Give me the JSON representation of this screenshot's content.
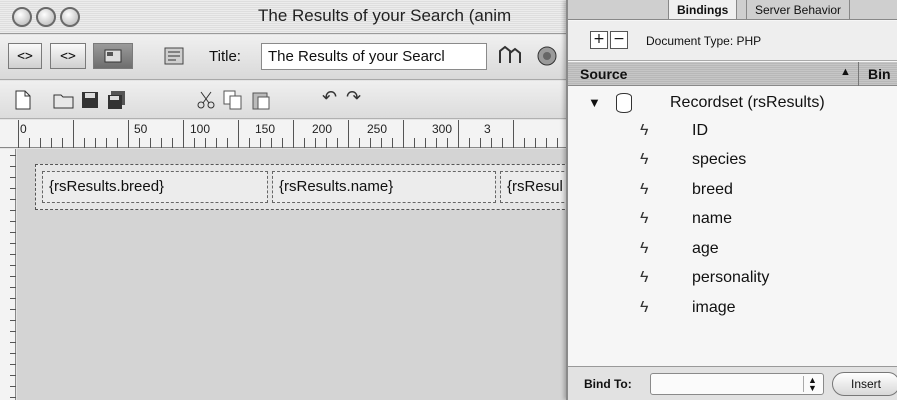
{
  "window": {
    "title": "The Results of your Search (anim"
  },
  "toolbar": {
    "code_view_label": "<>",
    "split_view_label": "<>",
    "design_view_label": "",
    "title_label": "Title:",
    "title_value": "The Results of your Searcl"
  },
  "ruler": {
    "labels": [
      "0",
      "50",
      "100",
      "150",
      "200",
      "250",
      "300",
      "3"
    ]
  },
  "design": {
    "cells": [
      "{rsResults.breed}",
      "{rsResults.name}",
      "{rsResul"
    ]
  },
  "panel": {
    "tabs": [
      "Bindings",
      "Server Behavior"
    ],
    "plus_label": "+",
    "minus_label": "−",
    "document_type": "Document Type: PHP",
    "source_header": "Source",
    "sort_arrow": "▲",
    "binding_header": "Bin",
    "recordset": {
      "disclosure": "▼",
      "label": "Recordset (rsResults)",
      "fields": [
        "ID",
        "species",
        "breed",
        "name",
        "age",
        "personality",
        "image"
      ]
    },
    "bind_to_label": "Bind To:",
    "insert_label": "Insert"
  },
  "icons": {
    "bolt": "ϟ",
    "undo": "↶",
    "redo": "↷"
  }
}
